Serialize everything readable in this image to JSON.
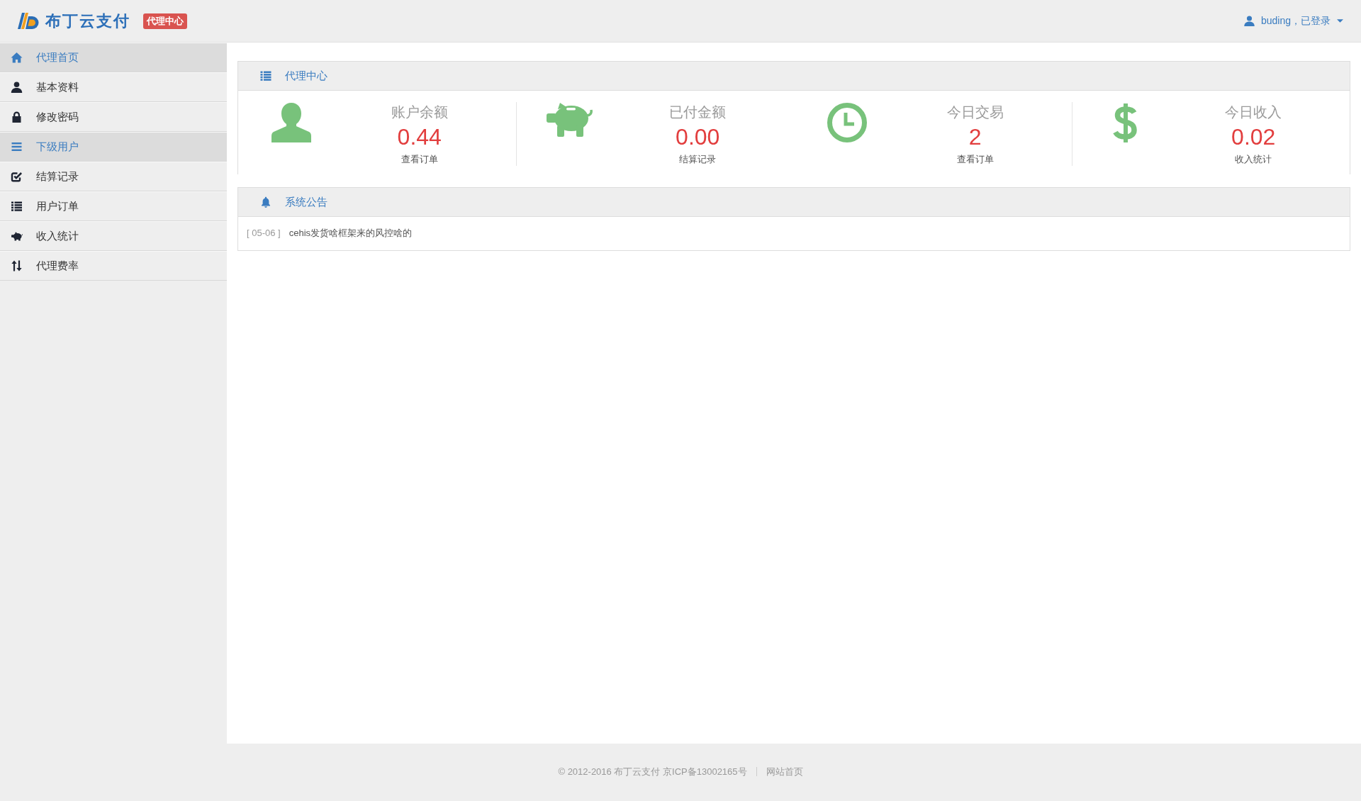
{
  "header": {
    "logo_text": "布丁云支付",
    "badge": "代理中心",
    "user_menu": "buding，已登录"
  },
  "sidebar": {
    "items": [
      {
        "label": "代理首页",
        "selected": true
      },
      {
        "label": "基本资料",
        "selected": false
      },
      {
        "label": "修改密码",
        "selected": false
      },
      {
        "label": "下级用户",
        "selected": true
      },
      {
        "label": "结算记录",
        "selected": false
      },
      {
        "label": "用户订单",
        "selected": false
      },
      {
        "label": "收入统计",
        "selected": false
      },
      {
        "label": "代理费率",
        "selected": false
      }
    ]
  },
  "agent_panel": {
    "title": "代理中心",
    "stats": [
      {
        "title": "账户余额",
        "value": "0.44",
        "link": "查看订单"
      },
      {
        "title": "已付金额",
        "value": "0.00",
        "link": "结算记录"
      },
      {
        "title": "今日交易",
        "value": "2",
        "link": "查看订单"
      },
      {
        "title": "今日收入",
        "value": "0.02",
        "link": "收入统计"
      }
    ]
  },
  "notice_panel": {
    "title": "系统公告",
    "notices": [
      {
        "date": "[ 05-06 ]",
        "text": "cehis发货啥框架来的风控啥的"
      }
    ]
  },
  "footer": {
    "copyright": "© 2012-2016 布丁云支付 京ICP备13002165号",
    "link": "网站首页"
  }
}
